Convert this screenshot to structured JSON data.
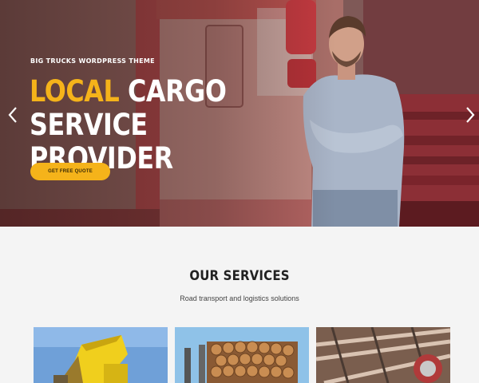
{
  "hero": {
    "kicker": "BIG TRUCKS WORDPRESS THEME",
    "title_accent": "LOCAL",
    "title_line1_rest": " CARGO",
    "title_line2": "SERVICE PROVIDER",
    "cta_label": "GET FREE QUOTE",
    "prev_icon": "chevron-left-icon",
    "next_icon": "chevron-right-icon"
  },
  "services": {
    "title": "OUR SERVICES",
    "subtitle": "Road transport and logistics solutions",
    "cards": [
      {
        "image": "dump-truck-photo"
      },
      {
        "image": "timber-logs-photo"
      },
      {
        "image": "construction-site-photo"
      }
    ]
  },
  "colors": {
    "accent": "#f5b31a",
    "background": "#f4f4f4",
    "heading": "#222222",
    "hero_text": "#ffffff"
  }
}
